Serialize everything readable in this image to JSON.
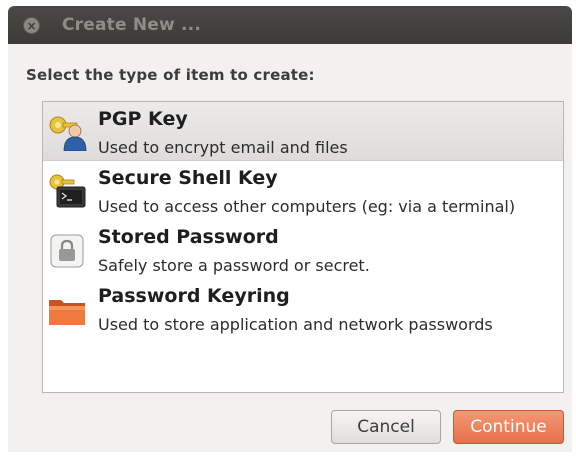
{
  "window": {
    "title": "Create New ..."
  },
  "dialog": {
    "prompt": "Select the type of item to create:",
    "items": [
      {
        "name": "PGP Key",
        "description": "Used to encrypt email and files",
        "icon": "pgp-key-icon",
        "selected": true
      },
      {
        "name": "Secure Shell Key",
        "description": "Used to access other computers (eg: via a terminal)",
        "icon": "ssh-key-icon",
        "selected": false
      },
      {
        "name": "Stored Password",
        "description": "Safely store a password or secret.",
        "icon": "lock-icon",
        "selected": false
      },
      {
        "name": "Password Keyring",
        "description": "Used to store application and network passwords",
        "icon": "folder-icon",
        "selected": false
      }
    ],
    "buttons": {
      "cancel": "Cancel",
      "continue": "Continue"
    }
  },
  "colors": {
    "titlebar": "#3c3b37",
    "accent": "#e7714a",
    "selection": "#dedcda"
  }
}
